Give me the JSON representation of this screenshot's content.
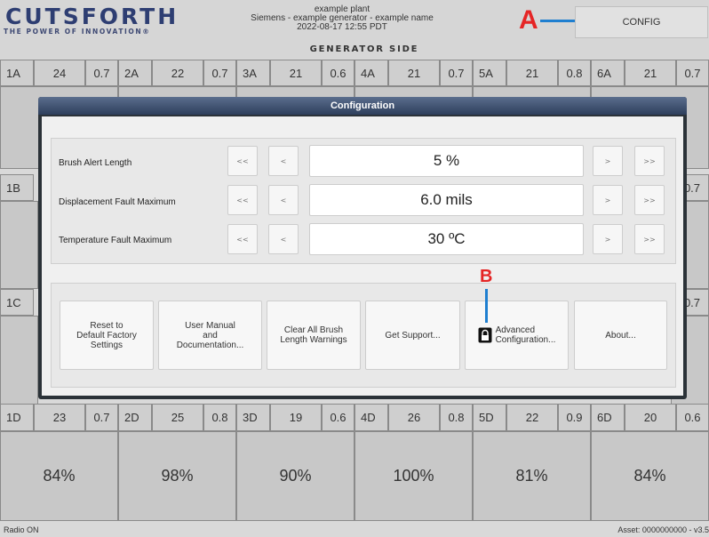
{
  "header": {
    "logo": "CUTSFORTH",
    "tagline": "THE POWER OF INNOVATION®",
    "plant": "example plant",
    "description": "Siemens - example generator - example name",
    "datetime": "2022-08-17 12:55 PDT",
    "side": "GENERATOR SIDE",
    "config_label": "CONFIG",
    "annotation_a": "A"
  },
  "rows": [
    {
      "cells": [
        {
          "id": "1A",
          "num": "24",
          "val": "0.7"
        },
        {
          "id": "2A",
          "num": "22",
          "val": "0.7"
        },
        {
          "id": "3A",
          "num": "21",
          "val": "0.6"
        },
        {
          "id": "4A",
          "num": "21",
          "val": "0.7"
        },
        {
          "id": "5A",
          "num": "21",
          "val": "0.8"
        },
        {
          "id": "6A",
          "num": "21",
          "val": "0.7"
        }
      ]
    },
    {
      "label": "1B",
      "last": "0.7"
    },
    {
      "label": "1C",
      "last": "0.7"
    },
    {
      "cells": [
        {
          "id": "1D",
          "num": "23",
          "val": "0.7",
          "pct": "84%"
        },
        {
          "id": "2D",
          "num": "25",
          "val": "0.8",
          "pct": "98%"
        },
        {
          "id": "3D",
          "num": "19",
          "val": "0.6",
          "pct": "90%"
        },
        {
          "id": "4D",
          "num": "26",
          "val": "0.8",
          "pct": "100%"
        },
        {
          "id": "5D",
          "num": "22",
          "val": "0.9",
          "pct": "81%"
        },
        {
          "id": "6D",
          "num": "20",
          "val": "0.6",
          "pct": "84%"
        }
      ]
    }
  ],
  "modal": {
    "title": "Configuration",
    "settings": [
      {
        "label": "Brush Alert Length",
        "value": "5 %"
      },
      {
        "label": "Displacement Fault Maximum",
        "value": "6.0 mils"
      },
      {
        "label": "Temperature Fault Maximum",
        "value": "30 ºC"
      }
    ],
    "step_labels": {
      "fast_back": "<<",
      "back": "<",
      "fwd": ">",
      "fast_fwd": ">>"
    },
    "buttons": {
      "reset": "Reset to\nDefault Factory\nSettings",
      "manual": "User Manual\nand\nDocumentation...",
      "clear": "Clear All Brush\nLength Warnings",
      "support": "Get Support...",
      "advanced": "Advanced\nConfiguration...",
      "about": "About..."
    },
    "annotation_b": "B"
  },
  "footer": {
    "left": "Radio ON",
    "right": "Asset: 0000000000 - v3.5"
  },
  "colors": {
    "annotation": "#e52525",
    "pointer": "#1f7fd0",
    "brand": "#2e3e72"
  }
}
